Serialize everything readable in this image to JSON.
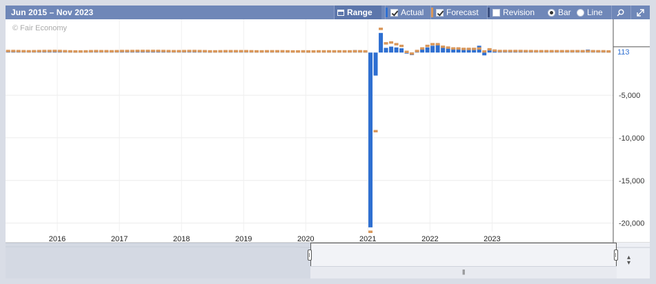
{
  "toolbar": {
    "range_text": "Jun 2015 – Nov 2023",
    "range_button": "Range",
    "actual_label": "Actual",
    "forecast_label": "Forecast",
    "revision_label": "Revision",
    "bar_label": "Bar",
    "line_label": "Line",
    "actual_checked": true,
    "forecast_checked": true,
    "revision_checked": false,
    "bar_selected": true,
    "icons": [
      "calendar-icon",
      "zoom-icon",
      "fullscreen-icon"
    ]
  },
  "watermark": "© Fair Economy",
  "colors": {
    "actual": "#2e6fd1",
    "forecast": "#d9975a",
    "toolbar": "#6f87b8",
    "current_label": "#2e6fd1"
  },
  "chart_data": {
    "type": "bar",
    "x_ticks": [
      "2016",
      "2017",
      "2018",
      "2019",
      "2020",
      "2021",
      "2022",
      "2023"
    ],
    "y_ticks": [
      -5000,
      -10000,
      -15000,
      -20000
    ],
    "y_tick_labels": [
      "-5,000",
      "-10,000",
      "-15,000",
      "-20,000"
    ],
    "current_value_label": "113",
    "ylim": [
      -21000,
      3900
    ],
    "grid": true,
    "series": [
      {
        "name": "Actual",
        "color": "#2e6fd1",
        "values": [
          190,
          200,
          180,
          160,
          170,
          200,
          210,
          200,
          220,
          240,
          200,
          150,
          150,
          110,
          130,
          140,
          190,
          210,
          150,
          190,
          160,
          200,
          240,
          200,
          200,
          250,
          230,
          230,
          220,
          260,
          190,
          180,
          150,
          200,
          230,
          240,
          270,
          200,
          200,
          110,
          170,
          200,
          210,
          210,
          190,
          180,
          200,
          150,
          160,
          170,
          220,
          200,
          170,
          190,
          120,
          140,
          150,
          220,
          100,
          150,
          200,
          160,
          200,
          180,
          170,
          180,
          170,
          290,
          250,
          180,
          -20500,
          -2700,
          2300,
          550,
          700,
          600,
          500,
          0,
          -300,
          200,
          400,
          600,
          800,
          1000,
          650,
          550,
          500,
          550,
          500,
          500,
          500,
          800,
          -330,
          400,
          280,
          240,
          260,
          250,
          250,
          300,
          230,
          240,
          190,
          200,
          210,
          180,
          240,
          180,
          200,
          270,
          300,
          200,
          350,
          260,
          200,
          210,
          150
        ]
      },
      {
        "name": "Forecast",
        "color": "#d9975a",
        "values": [
          200,
          200,
          190,
          180,
          170,
          180,
          190,
          200,
          200,
          210,
          200,
          180,
          160,
          150,
          150,
          160,
          180,
          190,
          180,
          180,
          170,
          180,
          200,
          200,
          200,
          210,
          210,
          210,
          210,
          210,
          200,
          190,
          180,
          180,
          190,
          200,
          200,
          190,
          180,
          160,
          160,
          170,
          180,
          180,
          180,
          180,
          180,
          170,
          160,
          160,
          170,
          170,
          170,
          170,
          160,
          150,
          150,
          160,
          150,
          150,
          160,
          160,
          160,
          160,
          160,
          160,
          160,
          170,
          170,
          160,
          -21000,
          -9200,
          2800,
          1100,
          1200,
          1000,
          800,
          100,
          -100,
          200,
          500,
          800,
          1000,
          1000,
          700,
          600,
          500,
          500,
          450,
          450,
          450,
          500,
          150,
          400,
          250,
          200,
          200,
          200,
          200,
          200,
          190,
          190,
          180,
          180,
          180,
          180,
          180,
          180,
          180,
          180,
          180,
          180,
          180,
          180,
          170,
          170,
          150
        ]
      }
    ]
  }
}
